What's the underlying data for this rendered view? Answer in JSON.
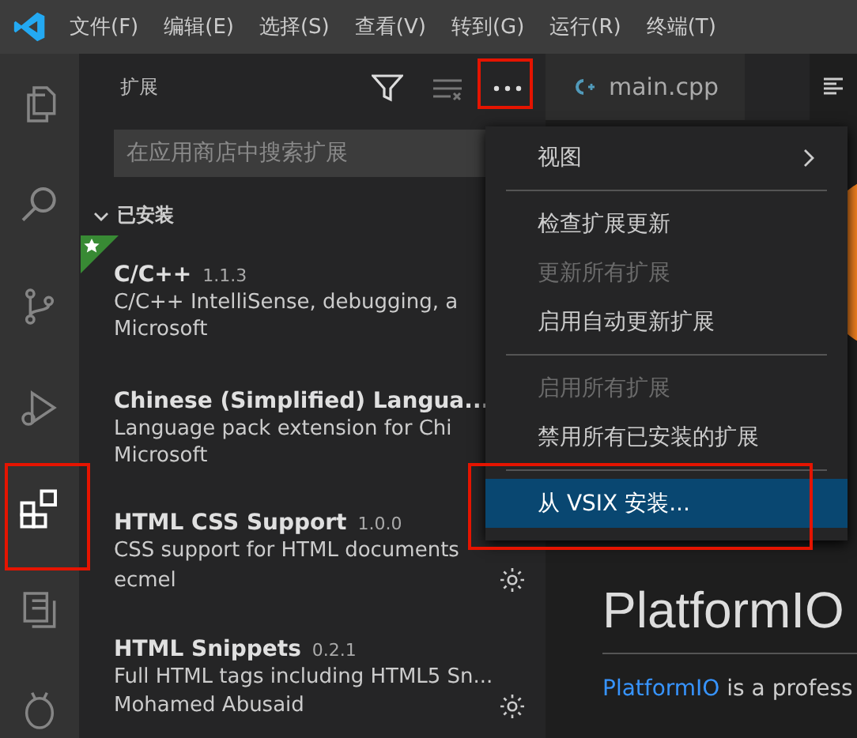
{
  "menubar": [
    "文件(F)",
    "编辑(E)",
    "选择(S)",
    "查看(V)",
    "转到(G)",
    "运行(R)",
    "终端(T)"
  ],
  "activity_bar": [
    {
      "kind": "files",
      "selected": false
    },
    {
      "kind": "search",
      "selected": false
    },
    {
      "kind": "source-control",
      "selected": false
    },
    {
      "kind": "run",
      "selected": false
    },
    {
      "kind": "extensions",
      "selected": true
    },
    {
      "kind": "remote",
      "selected": false
    },
    {
      "kind": "alien",
      "selected": false
    }
  ],
  "sidebar": {
    "title": "扩展",
    "search": {
      "placeholder": "在应用商店中搜索扩展"
    },
    "section": {
      "label": "已安装",
      "expanded": true
    },
    "extensions": [
      {
        "name": "C/C++",
        "version": "1.1.3",
        "description": "C/C++ IntelliSense, debugging, a",
        "publisher": "Microsoft",
        "recommended": true,
        "gear": false
      },
      {
        "name": "Chinese (Simplified) Langua...",
        "description": "Language pack extension for Chi",
        "publisher": "Microsoft",
        "recommended": false,
        "gear": false
      },
      {
        "name": "HTML CSS Support",
        "version": "1.0.0",
        "description": "CSS support for HTML documents",
        "publisher": "ecmel",
        "recommended": false,
        "gear": true
      },
      {
        "name": "HTML Snippets",
        "version": "0.2.1",
        "description": "Full HTML tags including HTML5 Sn...",
        "publisher": "Mohamed Abusaid",
        "recommended": false,
        "gear": true
      }
    ]
  },
  "editor": {
    "tabs": [
      {
        "label": "main.cpp",
        "selected": false
      }
    ],
    "heading": "PlatformIO",
    "paragraph_link": "PlatformIO",
    "paragraph_rest": " is a profess"
  },
  "context_menu": [
    {
      "kind": "submenu",
      "label": "视图",
      "disabled": false,
      "selected": false
    },
    {
      "kind": "separator"
    },
    {
      "kind": "item",
      "label": "检查扩展更新",
      "disabled": false,
      "selected": false
    },
    {
      "kind": "item",
      "label": "更新所有扩展",
      "disabled": true,
      "selected": false
    },
    {
      "kind": "item",
      "label": "启用自动更新扩展",
      "disabled": false,
      "selected": false
    },
    {
      "kind": "separator"
    },
    {
      "kind": "item",
      "label": "启用所有扩展",
      "disabled": true,
      "selected": false
    },
    {
      "kind": "item",
      "label": "禁用所有已安装的扩展",
      "disabled": false,
      "selected": false
    },
    {
      "kind": "separator"
    },
    {
      "kind": "item",
      "label": "从 VSIX 安装...",
      "disabled": false,
      "selected": true
    }
  ]
}
